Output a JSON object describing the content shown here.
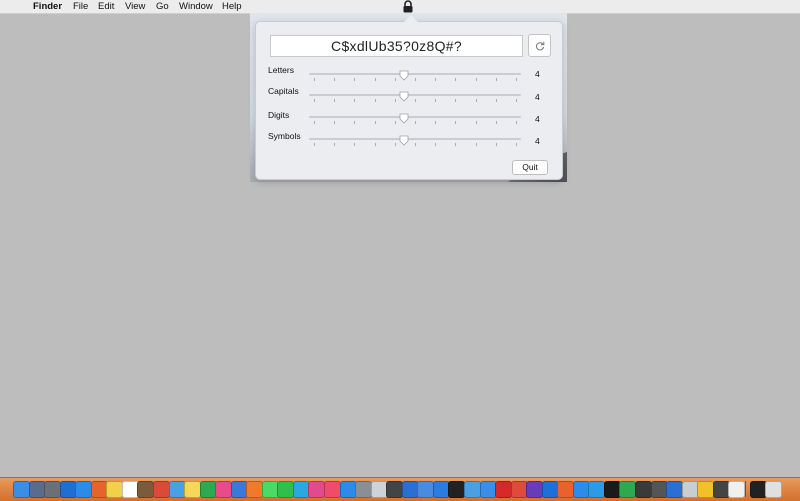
{
  "menubar": {
    "apple_glyph": "",
    "app_name": "Finder",
    "menus": [
      "File",
      "Edit",
      "View",
      "Go",
      "Window",
      "Help"
    ],
    "status_icon": "lock-icon"
  },
  "popover": {
    "password": "C$xdlUb35?0z8Q#?",
    "refresh_icon": "refresh-icon",
    "rows": [
      {
        "label": "Letters",
        "value": "4",
        "fraction": 0.45
      },
      {
        "label": "Capitals",
        "value": "4",
        "fraction": 0.45
      },
      {
        "label": "Digits",
        "value": "4",
        "fraction": 0.45
      },
      {
        "label": "Symbols",
        "value": "4",
        "fraction": 0.45
      }
    ],
    "quit_label": "Quit"
  },
  "dock": {
    "icons": [
      "finder-icon",
      "launchpad-icon",
      "rocket-icon",
      "outlook-icon",
      "mail-icon",
      "firefox-icon",
      "notes-icon",
      "calendar-icon",
      "photo-icon",
      "mail2-icon",
      "maps-icon",
      "stickies-icon",
      "numbers-icon",
      "photos-icon",
      "keynote-icon",
      "pages-icon",
      "messages-icon",
      "wechat-icon",
      "skype-icon",
      "itunes-icon",
      "music-icon",
      "appstore-icon",
      "settings-icon",
      "disk-icon",
      "clock-icon",
      "onepassword-icon",
      "bluetooth-icon",
      "xcode-icon",
      "terminal-icon",
      "preview-icon",
      "finder2-icon",
      "acrobat-icon",
      "pdf-icon",
      "visualstudio-icon",
      "vpn-icon",
      "firefox2-icon",
      "zoom-icon",
      "safari-icon",
      "iterm-icon",
      "sheets-icon",
      "screen-icon",
      "games-icon",
      "vpn2-icon",
      "box-icon",
      "run-icon",
      "tools-icon",
      "draft-icon",
      "lock-app-icon",
      "trash-icon"
    ],
    "colors": [
      "#3a8ee6",
      "#5b6b8c",
      "#6a6f78",
      "#1f6fd1",
      "#2d8be8",
      "#e8632a",
      "#f2d14a",
      "#ffffff",
      "#7a5b3a",
      "#d94a3a",
      "#4aa0e0",
      "#f5d75a",
      "#2fa84f",
      "#e94b8a",
      "#3b78d8",
      "#f07a2a",
      "#4cd964",
      "#2ec04a",
      "#2aa8e0",
      "#e24a8b",
      "#f24a6a",
      "#2d8ae8",
      "#8a8f96",
      "#cfd3d8",
      "#444",
      "#2a6fd1",
      "#4a8be0",
      "#2a7de0",
      "#222",
      "#4aa0e0",
      "#3a8ee6",
      "#d42a2a",
      "#e04a3a",
      "#6a3ab8",
      "#1e6fd8",
      "#e8632a",
      "#2d8ce8",
      "#2d9ae8",
      "#1a1a1a",
      "#2fa84f",
      "#3a3a3a",
      "#555",
      "#2a6fd1",
      "#c9cdd2",
      "#f2c12a",
      "#444",
      "#f0f0f0",
      "#222",
      "#e0e0e0"
    ]
  }
}
